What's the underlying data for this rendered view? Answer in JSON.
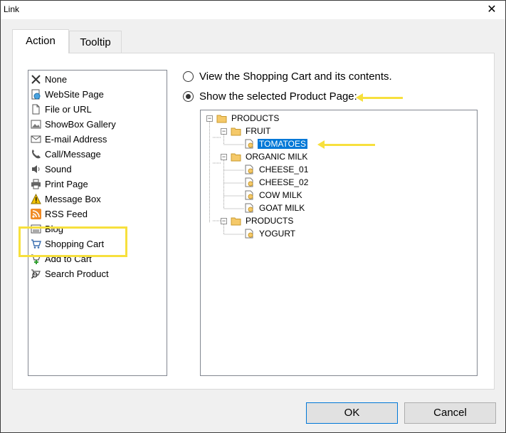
{
  "window": {
    "title": "Link",
    "close_glyph": "✕"
  },
  "tabs": [
    {
      "label": "Action",
      "active": true
    },
    {
      "label": "Tooltip",
      "active": false
    }
  ],
  "actions": [
    {
      "label": "None",
      "icon": "x-icon"
    },
    {
      "label": "WebSite Page",
      "icon": "globe-page-icon"
    },
    {
      "label": "File or URL",
      "icon": "file-icon"
    },
    {
      "label": "ShowBox Gallery",
      "icon": "gallery-icon"
    },
    {
      "label": "E-mail Address",
      "icon": "email-icon"
    },
    {
      "label": "Call/Message",
      "icon": "phone-icon"
    },
    {
      "label": "Sound",
      "icon": "speaker-icon"
    },
    {
      "label": "Print Page",
      "icon": "printer-icon"
    },
    {
      "label": "Message Box",
      "icon": "warning-icon"
    },
    {
      "label": "RSS Feed",
      "icon": "rss-icon"
    },
    {
      "label": "Blog",
      "icon": "blog-icon"
    },
    {
      "label": "Shopping Cart",
      "icon": "cart-icon",
      "selected": true
    },
    {
      "label": "Add to Cart",
      "icon": "add-to-cart-icon"
    },
    {
      "label": "Search Product",
      "icon": "search-product-icon"
    }
  ],
  "options": {
    "view_cart": "View the Shopping Cart and its contents.",
    "show_product": "Show the selected Product Page:",
    "selected": "show_product"
  },
  "tree": [
    {
      "label": "PRODUCTS",
      "type": "folder",
      "expanded": true
    },
    {
      "label": "FRUIT",
      "type": "folder",
      "expanded": true
    },
    {
      "label": "TOMATOES",
      "type": "product",
      "selected": true
    },
    {
      "label": "ORGANIC MILK",
      "type": "folder",
      "expanded": true
    },
    {
      "label": "CHEESE_01",
      "type": "product"
    },
    {
      "label": "CHEESE_02",
      "type": "product"
    },
    {
      "label": "COW MILK",
      "type": "product"
    },
    {
      "label": "GOAT MILK",
      "type": "product"
    },
    {
      "label": "PRODUCTS",
      "type": "folder",
      "expanded": true
    },
    {
      "label": "YOGURT",
      "type": "product"
    }
  ],
  "buttons": {
    "ok": "OK",
    "cancel": "Cancel"
  },
  "colors": {
    "highlight": "#f7e03d",
    "selection": "#0078d7",
    "folder": "#f5c969"
  }
}
